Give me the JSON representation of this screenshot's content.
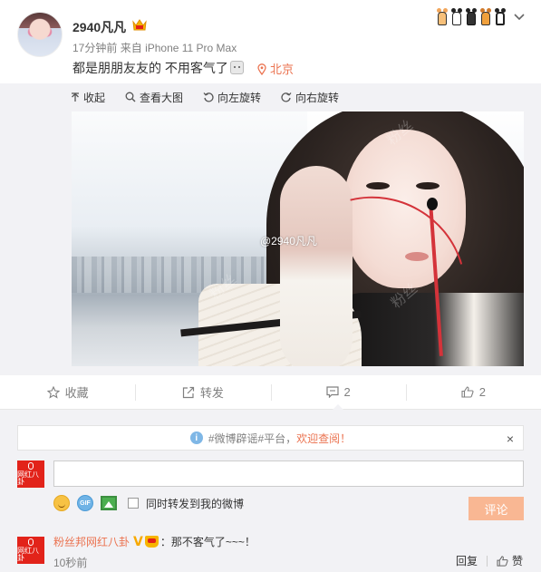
{
  "post": {
    "username": "2940凡凡",
    "time": "17分钟前",
    "source_prefix": "来自",
    "source": "iPhone 11 Pro Max",
    "text": "都是朋朋友友的 不用客气了",
    "location": "北京"
  },
  "media_toolbar": {
    "collapse": "收起",
    "view_large": "查看大图",
    "rotate_left": "向左旋转",
    "rotate_right": "向右旋转"
  },
  "photo": {
    "watermark": "@2940凡凡",
    "faint_mark": "粉丝"
  },
  "actions": {
    "favorite": "收藏",
    "repost": "转发",
    "comment_count": "2",
    "like_count": "2"
  },
  "notice": {
    "hashtag": "#微博辟谣#平台，",
    "link": "欢迎查阅！",
    "close": "×"
  },
  "composer": {
    "input_value": "",
    "avatar_text": "网红八卦",
    "forward_label": "同时转发到我的微博",
    "submit_label": "评论"
  },
  "comment": {
    "avatar_text": "网红八卦",
    "user": "粉丝邦网红八卦",
    "verified": "V",
    "text": "：那不客气了~~~！",
    "time": "10秒前",
    "reply": "回复",
    "like": "赞"
  },
  "colors": {
    "accent": "#eb7350",
    "submit_bg": "#f9b793",
    "brand_red": "#e2231a",
    "panel_bg": "#f2f2f5"
  }
}
